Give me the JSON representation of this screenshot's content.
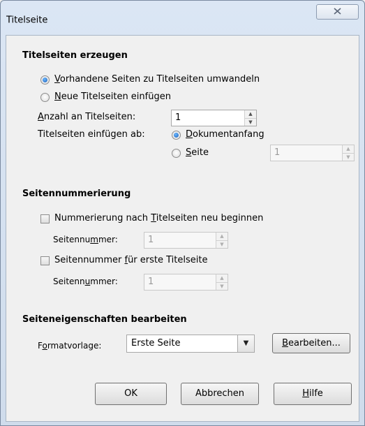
{
  "window": {
    "title": "Titelseite",
    "close_icon": "close-icon"
  },
  "section_create": {
    "title": "Titelseiten erzeugen",
    "radio_convert": {
      "pre": "",
      "key": "V",
      "post": "orhandene Seiten zu Titelseiten umwandeln",
      "checked": true
    },
    "radio_insert": {
      "pre": "",
      "key": "N",
      "post": "eue Titelseiten einfügen",
      "checked": false
    },
    "count_label": {
      "pre": "",
      "key": "A",
      "post": "nzahl an Titelseiten:"
    },
    "count_value": "1",
    "insert_at_label": "Titelseiten einfügen ab:",
    "radio_doc_start": {
      "pre": "",
      "key": "D",
      "post": "okumentanfang",
      "checked": true
    },
    "radio_page": {
      "pre": "",
      "key": "S",
      "post": "eite",
      "checked": false
    },
    "page_value": "1"
  },
  "section_numbering": {
    "title": "Seitennummerierung",
    "check_restart": {
      "pre": "Nummerierung nach ",
      "key": "T",
      "post": "itelseiten neu beginnen",
      "checked": false
    },
    "pagenum1_label": {
      "pre": "Seitennu",
      "key": "m",
      "post": "mer:"
    },
    "pagenum1_value": "1",
    "check_first": {
      "pre": "Seitennummer ",
      "key": "f",
      "post": "ür erste Titelseite",
      "checked": false
    },
    "pagenum2_label": {
      "pre": "Seitenn",
      "key": "u",
      "post": "mmer:"
    },
    "pagenum2_value": "1"
  },
  "section_props": {
    "title": "Seiteneigenschaften bearbeiten",
    "style_label": {
      "pre": "F",
      "key": "o",
      "post": "rmatvorlage:"
    },
    "style_value": "Erste Seite",
    "edit_button": {
      "pre": "",
      "key": "B",
      "post": "earbeiten..."
    }
  },
  "buttons": {
    "ok": "OK",
    "cancel": "Abbrechen",
    "help": {
      "pre": "",
      "key": "H",
      "post": "ilfe"
    }
  }
}
